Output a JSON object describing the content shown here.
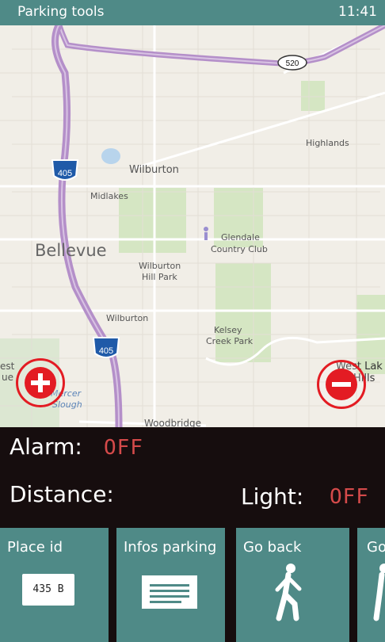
{
  "status_bar": {
    "app_title": "Parking tools",
    "time": "11:41"
  },
  "map": {
    "labels": {
      "wilburton": "Wilburton",
      "midlakes": "Midlakes",
      "bellevue": "Bellevue",
      "wilburton_hill_park_1": "Wilburton",
      "wilburton_hill_park_2": "Hill Park",
      "glendale_1": "Glendale",
      "glendale_2": "Country Club",
      "highlands": "Highlands",
      "wilburton_south": "Wilburton",
      "kelsey_1": "Kelsey",
      "kelsey_2": "Creek Park",
      "west_lake_1": "West Lak",
      "west_lake_2": "Hills",
      "west_1": "est",
      "west_2": "ue",
      "mercer_1": "Mercer",
      "mercer_2": "Slough",
      "woodbridge": "Woodbridge"
    },
    "shields": {
      "i405_north": "405",
      "i405_south": "405",
      "sr520": "520"
    },
    "zoom_in_icon": "plus-circle-icon",
    "zoom_out_icon": "minus-circle-icon"
  },
  "info": {
    "alarm_label": "Alarm:",
    "alarm_value": "OFF",
    "distance_label": "Distance:",
    "light_label": "Light:",
    "light_value": "OFF"
  },
  "tiles": [
    {
      "label": "Place id",
      "plate_text": "435 B",
      "icon": "license-plate-icon"
    },
    {
      "label": "Infos parking",
      "icon": "document-lines-icon"
    },
    {
      "label": "Go back",
      "icon": "walking-person-icon"
    },
    {
      "label": "Go",
      "icon": "walking-person-icon"
    }
  ],
  "colors": {
    "accent": "#4f8a87",
    "alarm_off": "#d44a4a",
    "zoom_red": "#e31c23",
    "background": "#160d0e"
  }
}
